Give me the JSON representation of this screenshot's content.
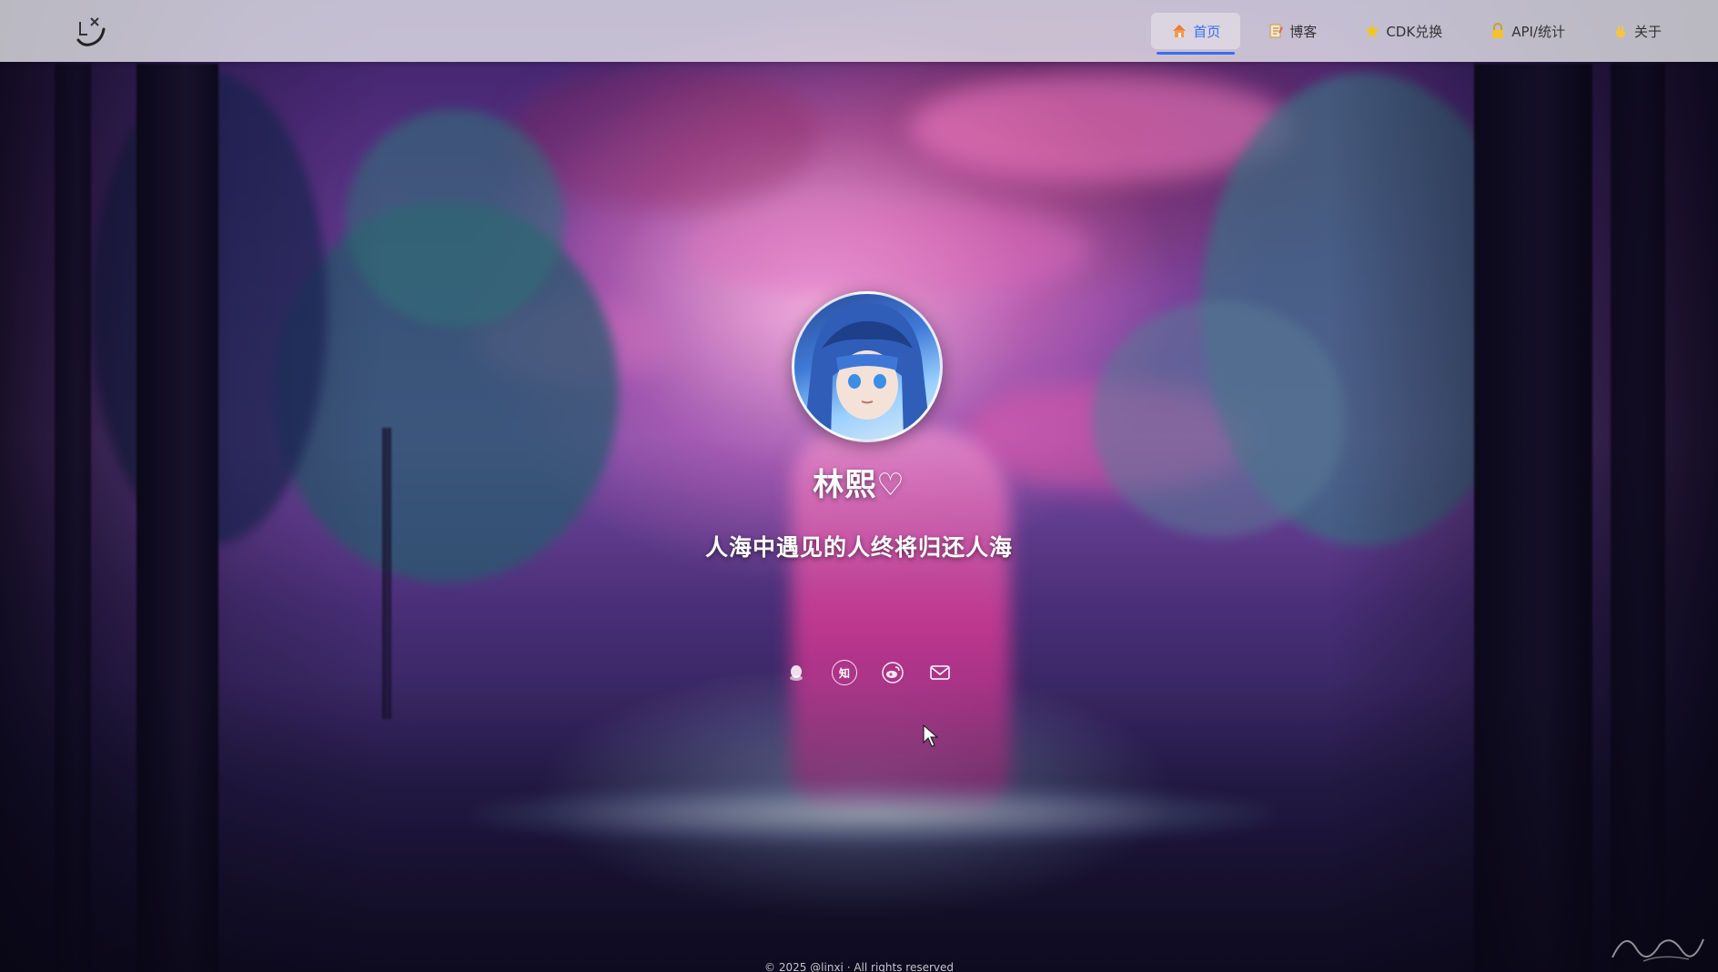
{
  "nav": {
    "items": [
      {
        "label": "首页",
        "icon": "home-icon",
        "active": true
      },
      {
        "label": "博客",
        "icon": "blog-icon",
        "active": false
      },
      {
        "label": "CDK兑换",
        "icon": "star-icon",
        "active": false
      },
      {
        "label": "API/统计",
        "icon": "lock-icon",
        "active": false
      },
      {
        "label": "关于",
        "icon": "hand-icon",
        "active": false
      }
    ],
    "accent_color": "#3b6ef0"
  },
  "profile": {
    "name": "林熙♡",
    "motto": "人海中遇见的人终将归还人海",
    "socials": [
      {
        "icon": "qq-icon"
      },
      {
        "icon": "zhihu-icon",
        "glyph": "知"
      },
      {
        "icon": "weibo-icon"
      },
      {
        "icon": "mail-icon"
      }
    ]
  },
  "footer": {
    "link_text": "",
    "copyright": "© 2025 @linxi · All rights reserved"
  }
}
